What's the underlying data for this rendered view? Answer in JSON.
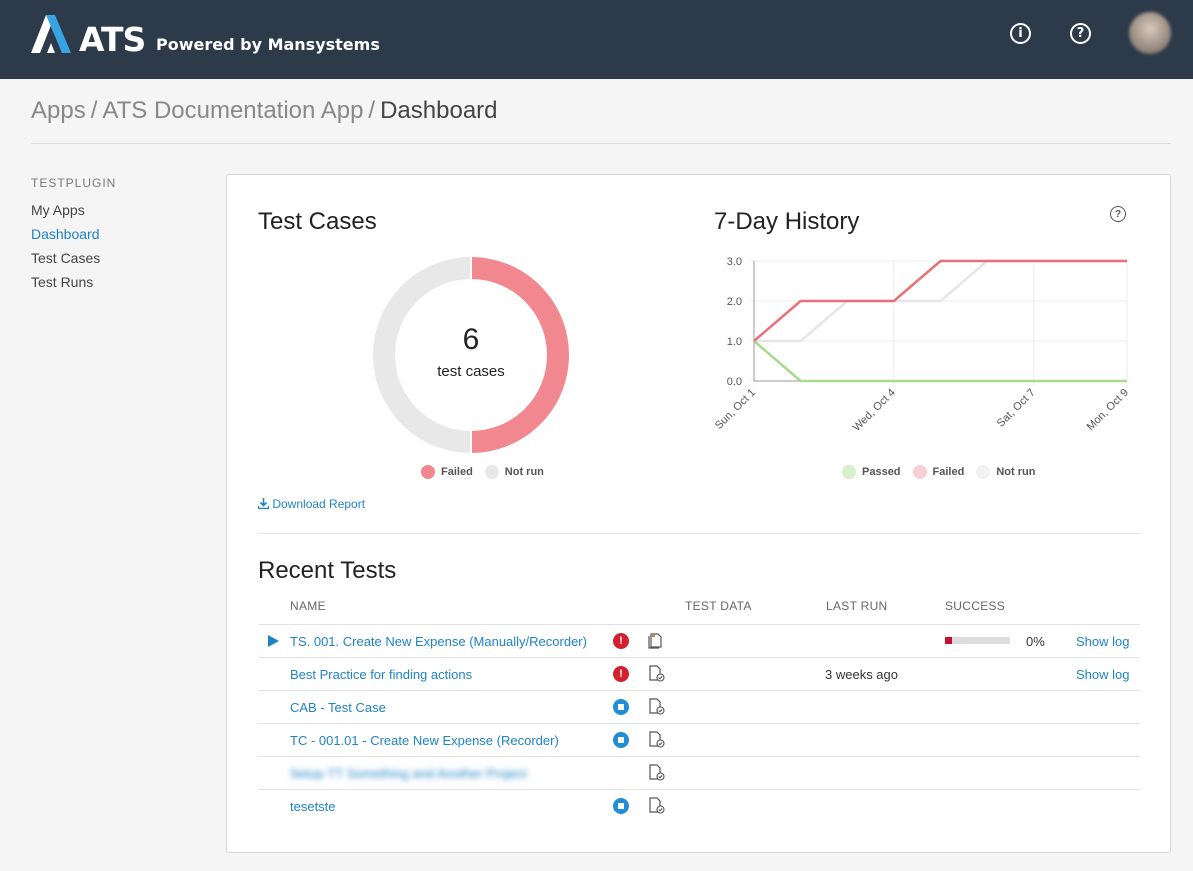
{
  "header": {
    "brand": "ATS",
    "brand_sub": "Powered by Mansystems",
    "info_icon": "info-icon",
    "help_icon": "help-icon"
  },
  "breadcrumb": {
    "items": [
      "Apps",
      "ATS Documentation App",
      "Dashboard"
    ],
    "separator": "/"
  },
  "sidebar": {
    "title": "TESTPLUGIN",
    "items": [
      {
        "label": "My Apps",
        "active": false
      },
      {
        "label": "Dashboard",
        "active": true
      },
      {
        "label": "Test Cases",
        "active": false
      },
      {
        "label": "Test Runs",
        "active": false
      }
    ]
  },
  "test_cases": {
    "title": "Test Cases",
    "total": "6",
    "total_label": "test cases",
    "legend": [
      {
        "label": "Failed",
        "color": "#f2888f"
      },
      {
        "label": "Not run",
        "color": "#e8e8e8"
      }
    ],
    "download_label": "Download Report"
  },
  "history": {
    "title": "7-Day History",
    "legend": [
      {
        "label": "Passed",
        "color": "#d6efcc"
      },
      {
        "label": "Failed",
        "color": "#f8cfd2"
      },
      {
        "label": "Not run",
        "color": "#f2f2f2"
      }
    ]
  },
  "recent_tests": {
    "title": "Recent Tests",
    "columns": {
      "name": "NAME",
      "test_data": "TEST DATA",
      "last_run": "LAST RUN",
      "success": "SUCCESS"
    },
    "rows": [
      {
        "name": "TS. 001. Create New Expense (Manually/Recorder)",
        "status": "error",
        "playable": true,
        "last_run": "",
        "success_pct": "0%",
        "success_fraction": 0.1,
        "show_log": "Show log",
        "blurred": false
      },
      {
        "name": "Best Practice for finding actions",
        "status": "error",
        "playable": false,
        "last_run": "3 weeks ago",
        "success_pct": "",
        "show_log": "Show log",
        "blurred": false
      },
      {
        "name": "CAB - Test Case",
        "status": "queued",
        "playable": false,
        "last_run": "",
        "success_pct": "",
        "show_log": "",
        "blurred": false
      },
      {
        "name": "TC - 001.01 - Create New Expense (Recorder)",
        "status": "queued",
        "playable": false,
        "last_run": "",
        "success_pct": "",
        "show_log": "",
        "blurred": false
      },
      {
        "name": "Setup TT Something and Another Project",
        "status": "none",
        "playable": false,
        "last_run": "",
        "success_pct": "",
        "show_log": "",
        "blurred": true
      },
      {
        "name": "tesetste",
        "status": "queued",
        "playable": false,
        "last_run": "",
        "success_pct": "",
        "show_log": "",
        "blurred": false
      }
    ]
  },
  "chart_data": [
    {
      "type": "pie",
      "title": "Test Cases",
      "categories": [
        "Failed",
        "Not run"
      ],
      "values": [
        3,
        3
      ],
      "center_text": "6 test cases",
      "colors": [
        "#f2888f",
        "#e8e8e8"
      ]
    },
    {
      "type": "line",
      "title": "7-Day History",
      "x": [
        "Sun, Oct 1",
        "Mon, Oct 2",
        "Tue, Oct 3",
        "Wed, Oct 4",
        "Thu, Oct 5",
        "Fri, Oct 6",
        "Sat, Oct 7",
        "Sun, Oct 8",
        "Mon, Oct 9"
      ],
      "x_tick_labels": [
        "Sun, Oct 1",
        "Wed, Oct 4",
        "Sat, Oct 7",
        "Mon, Oct 9"
      ],
      "y_tick_labels": [
        "0.0",
        "1.0",
        "2.0",
        "3.0"
      ],
      "ylim": [
        0,
        3
      ],
      "grid": true,
      "legend_position": "bottom",
      "series": [
        {
          "name": "Passed",
          "color": "#a8d98f",
          "values": [
            1,
            0,
            0,
            0,
            0,
            0,
            0,
            0,
            0
          ]
        },
        {
          "name": "Failed",
          "color": "#e8707a",
          "values": [
            1,
            2,
            2,
            2,
            3,
            3,
            3,
            3,
            3
          ]
        },
        {
          "name": "Not run",
          "color": "#e6e6e6",
          "values": [
            1,
            1,
            2,
            2,
            2,
            3,
            3,
            3,
            3
          ]
        }
      ]
    }
  ]
}
